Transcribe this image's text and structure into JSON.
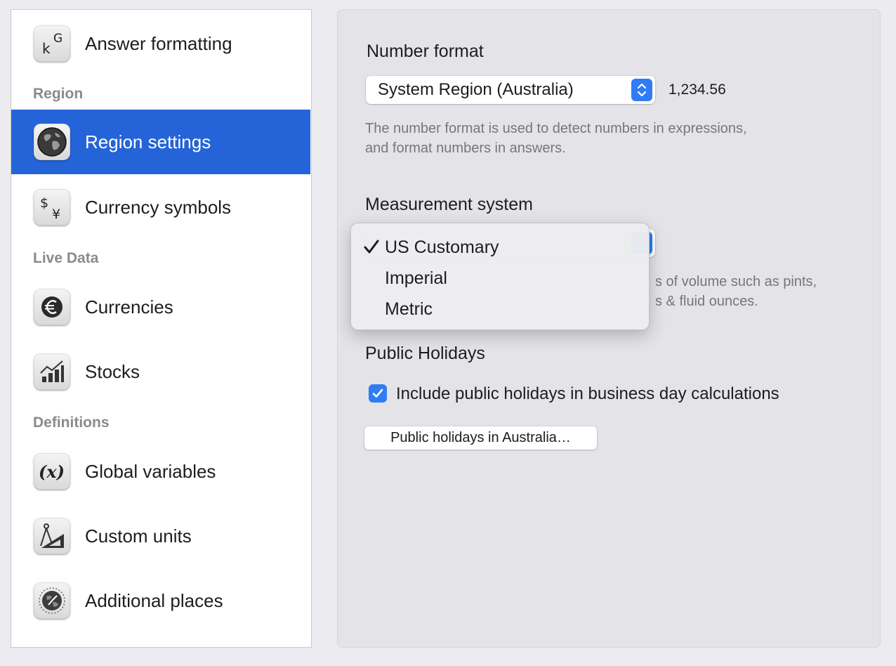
{
  "sidebar": {
    "items": [
      {
        "label": "Answer formatting",
        "icon": "answer-formatting-icon"
      },
      {
        "label": "Region settings",
        "icon": "globe-icon",
        "selected": true
      },
      {
        "label": "Currency symbols",
        "icon": "currency-symbols-icon"
      },
      {
        "label": "Currencies",
        "icon": "euro-coin-icon"
      },
      {
        "label": "Stocks",
        "icon": "stocks-chart-icon"
      },
      {
        "label": "Global variables",
        "icon": "variable-x-icon"
      },
      {
        "label": "Custom units",
        "icon": "compass-ruler-icon"
      },
      {
        "label": "Additional places",
        "icon": "world-clock-icon"
      }
    ],
    "sections": [
      "Region",
      "Live Data",
      "Definitions"
    ],
    "icon_glyphs": {
      "answer_formatting": [
        "k",
        "G"
      ],
      "currency_symbols": [
        "$",
        "¥"
      ],
      "global_variables": "(x)"
    }
  },
  "main": {
    "number_format": {
      "heading": "Number format",
      "selected": "System Region (Australia)",
      "example": "1,234.56",
      "description_line1": "The number format is used to detect numbers in expressions,",
      "description_line2": "and format numbers in answers."
    },
    "measurement": {
      "heading": "Measurement system",
      "description_line1": "s of volume such as pints,",
      "description_line2": "s & fluid ounces."
    },
    "holidays": {
      "heading": "Public Holidays",
      "checkbox_label": "Include public holidays in business day calculations",
      "checked": true,
      "button_label": "Public holidays in Australia…"
    }
  },
  "dropdown": {
    "selected_mark": "✓",
    "options": [
      "US Customary",
      "Imperial",
      "Metric"
    ],
    "selected_index": 0
  },
  "colors": {
    "selection": "#2563d8",
    "accent": "#2f7cf6"
  }
}
